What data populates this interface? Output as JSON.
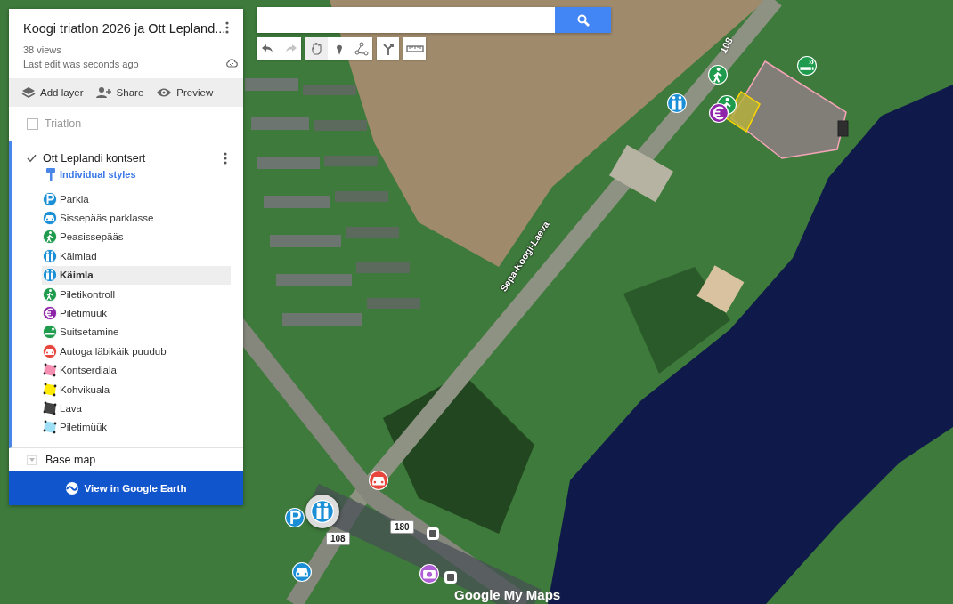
{
  "panel": {
    "title": "Koogi triatlon 2026 ja Ott Lepland...",
    "views": "38 views",
    "last_edit": "Last edit was seconds ago",
    "actions": [
      {
        "kind": "layers",
        "label": "Add layer"
      },
      {
        "kind": "share",
        "label": "Share"
      },
      {
        "kind": "preview",
        "label": "Preview"
      }
    ],
    "layers": [
      {
        "name": "Triatlon",
        "checked": false,
        "active": false
      },
      {
        "name": "Ott Leplandi kontsert",
        "checked": true,
        "active": true,
        "styles_label": "Individual styles",
        "items": [
          {
            "label": "Parkla",
            "kind": "parking",
            "color": "#1a8fd6",
            "selected": false
          },
          {
            "label": "Sissepääs parklasse",
            "kind": "car",
            "color": "#1a8fd6",
            "selected": false
          },
          {
            "label": "Peasissepääs",
            "kind": "walk",
            "color": "#1e9b4c",
            "selected": false
          },
          {
            "label": "Käimlad",
            "kind": "toilet",
            "color": "#1a8fd6",
            "selected": false
          },
          {
            "label": "Käimla",
            "kind": "toilet",
            "color": "#1a8fd6",
            "selected": true
          },
          {
            "label": "Piletikontroll",
            "kind": "walk",
            "color": "#1e9b4c",
            "selected": false
          },
          {
            "label": "Piletimüük",
            "kind": "euro",
            "color": "#8e24aa",
            "selected": false
          },
          {
            "label": "Suitsetamine",
            "kind": "smoking",
            "color": "#1e9b4c",
            "selected": false
          },
          {
            "label": "Autoga läbikäik puudub",
            "kind": "car",
            "color": "#e8453c",
            "selected": false
          },
          {
            "label": "Kontserdiala",
            "kind": "polygon",
            "color": "#f48fb1",
            "selected": false
          },
          {
            "label": "Kohvikuala",
            "kind": "polygon",
            "color": "#ffea00",
            "selected": false
          },
          {
            "label": "Lava",
            "kind": "polygon",
            "color": "#444444",
            "selected": false
          },
          {
            "label": "Piletimüük",
            "kind": "polygon",
            "color": "#9fdff5",
            "selected": false
          }
        ]
      }
    ],
    "base_map": "Base map",
    "earth_button": "View in Google Earth"
  },
  "toolbar": {
    "groups": [
      [
        {
          "kind": "undo",
          "disabled": false
        },
        {
          "kind": "redo",
          "disabled": true
        }
      ],
      [
        {
          "kind": "hand",
          "selected": true
        },
        {
          "kind": "marker",
          "selected": false
        },
        {
          "kind": "line",
          "selected": false
        }
      ],
      [
        {
          "kind": "directions"
        }
      ],
      [
        {
          "kind": "measure"
        }
      ]
    ]
  },
  "map": {
    "road_name": "Sepa-Koogi-Laeva",
    "road_numbers": [
      "108",
      "108",
      "180"
    ],
    "markers": [
      {
        "kind": "walk",
        "color": "#1e9b4c",
        "selected": false
      },
      {
        "kind": "toilet",
        "color": "#1a8fd6",
        "selected": false
      },
      {
        "kind": "walk",
        "color": "#1e9b4c",
        "selected": false
      },
      {
        "kind": "euro",
        "color": "#8e24aa",
        "selected": false
      },
      {
        "kind": "smoking",
        "color": "#1e9b4c",
        "selected": false
      },
      {
        "kind": "car",
        "color": "#e8453c",
        "selected": false
      },
      {
        "kind": "parking",
        "color": "#1a8fd6",
        "selected": false
      },
      {
        "kind": "toilet",
        "color": "#1a8fd6",
        "selected": true
      },
      {
        "kind": "car",
        "color": "#1a8fd6",
        "selected": false
      },
      {
        "kind": "camera",
        "color": "#b05fd6",
        "selected": false
      }
    ],
    "logo": "Google My Maps"
  }
}
